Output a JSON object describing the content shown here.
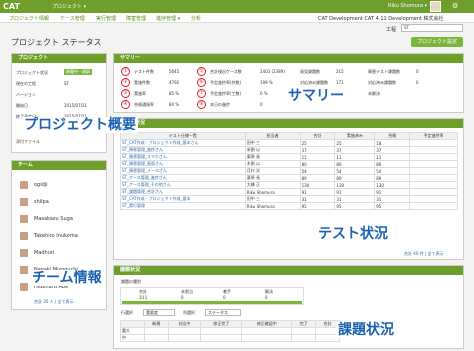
{
  "header": {
    "logo": "CAT",
    "logo_sub": "COMPUTER AIDED TEST",
    "project_menu": "プロジェクト ▾",
    "user": "Riku Shomura ▾"
  },
  "nav": {
    "items": [
      "プロジェクト情報",
      "ケース管理",
      "実行管理",
      "障害管理",
      "進捗管理 ▾",
      "分析"
    ],
    "dev_title": "CAT Development  CAT 4.11 Development 株式会社"
  },
  "work": {
    "label": "工程",
    "value": "ST"
  },
  "page": {
    "title": "プロジェクト ステータス",
    "settings_button": "プロジェクト設定"
  },
  "overview": {
    "header": "プロジェクト",
    "rows": [
      {
        "k": "プロジェクト状況",
        "v": "稼働中"
      },
      {
        "k": "現在の工程",
        "v": "ST"
      },
      {
        "k": "バージョン",
        "v": ""
      },
      {
        "k": "開始日",
        "v": "2015/07/21"
      },
      {
        "k": "終了予定日",
        "v": "2015/07/21"
      }
    ],
    "badge": "稼働中・順調",
    "edit": "レポート",
    "files": "添付ファイル",
    "overlay": "プロジェクト概要"
  },
  "summary": {
    "header": "サマリー",
    "overlay": "サマリー",
    "items": [
      {
        "n": "①",
        "k": "テスト件数",
        "v": "5645"
      },
      {
        "n": "②",
        "k": "実施件数",
        "v": "4792"
      },
      {
        "n": "③",
        "k": "実施率",
        "v": "85 %"
      },
      {
        "n": "④",
        "k": "合格通過率",
        "v": "84 %"
      },
      {
        "n": "⑤",
        "k": "合計検出ケース数",
        "v": "2403 (2389)"
      },
      {
        "n": "⑥",
        "k": "予定進捗率(件数)",
        "v": "199 %"
      },
      {
        "n": "⑦",
        "k": "予定進捗率(工数)",
        "v": "0 %"
      },
      {
        "n": "⑧",
        "k": "本日の進捗",
        "v": "0"
      }
    ],
    "right": [
      {
        "k": "発見課題数",
        "v": "215"
      },
      {
        "k": "対応済み課題数",
        "v": "171"
      },
      {
        "k": "未解決",
        "v": ""
      }
    ],
    "right2": [
      {
        "k": "障害テスト課題数",
        "v": "0"
      },
      {
        "k": "対応済み課題数",
        "v": "0"
      },
      {
        "k": "未解決",
        "v": ""
      }
    ]
  },
  "tests": {
    "header": "テスト状況",
    "overlay": "テスト状況",
    "columns": [
      "テスト仕様一覧",
      "担当者",
      "合計",
      "実施済み",
      "合格",
      "予定進捗率"
    ],
    "rows": [
      [
        "ST_CAT作成・プロジェクト作成_基本さん",
        "田中 三",
        "25",
        "25",
        "18",
        ""
      ],
      [
        "ST_障害管理_進捗さん",
        "米割 以",
        "37",
        "37",
        "37",
        ""
      ],
      [
        "ST_障害管理_スマホさん",
        "栗原 長",
        "11",
        "11",
        "11",
        ""
      ],
      [
        "ST_障害管理_画面さん",
        "木割 以",
        "80",
        "80",
        "80",
        ""
      ],
      [
        "ST_障害管理_メールさん",
        "月村 次",
        "54",
        "54",
        "54",
        ""
      ],
      [
        "ST_ケース管理_進捗さん",
        "栗原 長",
        "89",
        "89",
        "89",
        ""
      ],
      [
        "ST_ケース管理_その他さん",
        "大橋 正",
        "130",
        "130",
        "130",
        ""
      ],
      [
        "ST_課題管理_合計さん",
        "Riku Shomura",
        "91",
        "91",
        "91",
        ""
      ],
      [
        "ST_CAT作成・プロジェクト作成_基本",
        "田中 三",
        "31",
        "31",
        "31",
        ""
      ],
      [
        "ST_実行管理",
        "Riku Shomura",
        "95",
        "95",
        "95",
        ""
      ]
    ],
    "footer": "合計 40 件 | 全て表示"
  },
  "team": {
    "header": "チーム",
    "overlay": "チーム情報",
    "members": [
      "ogidji",
      "shilpa",
      "Masakazu Suga",
      "Takehiro Inukoma",
      "Madhuri",
      "Naoaki Mizoguchi",
      "Hideharu Abe"
    ],
    "footer": "合計 20 人 | 全て表示"
  },
  "issues": {
    "header": "課題状況",
    "overlay": "課題状況",
    "subtitle": "課題の種別",
    "stats": [
      {
        "k": "合計",
        "v": "211"
      },
      {
        "k": "未割当",
        "v": "0"
      },
      {
        "k": "着手",
        "v": "0"
      },
      {
        "k": "解決",
        "v": "0"
      }
    ],
    "filter_label1": "行選択",
    "filter_val1": "重要度",
    "filter_label2": "列選択",
    "filter_val2": "ステータス",
    "columns": [
      "",
      "新規",
      "対応中",
      "修正完了",
      "修正確認中",
      "完了",
      "合計"
    ],
    "rows": [
      [
        "重大",
        "",
        "",
        "",
        "",
        "",
        ""
      ],
      [
        "中",
        "",
        "",
        "",
        "",
        "",
        ""
      ]
    ]
  }
}
